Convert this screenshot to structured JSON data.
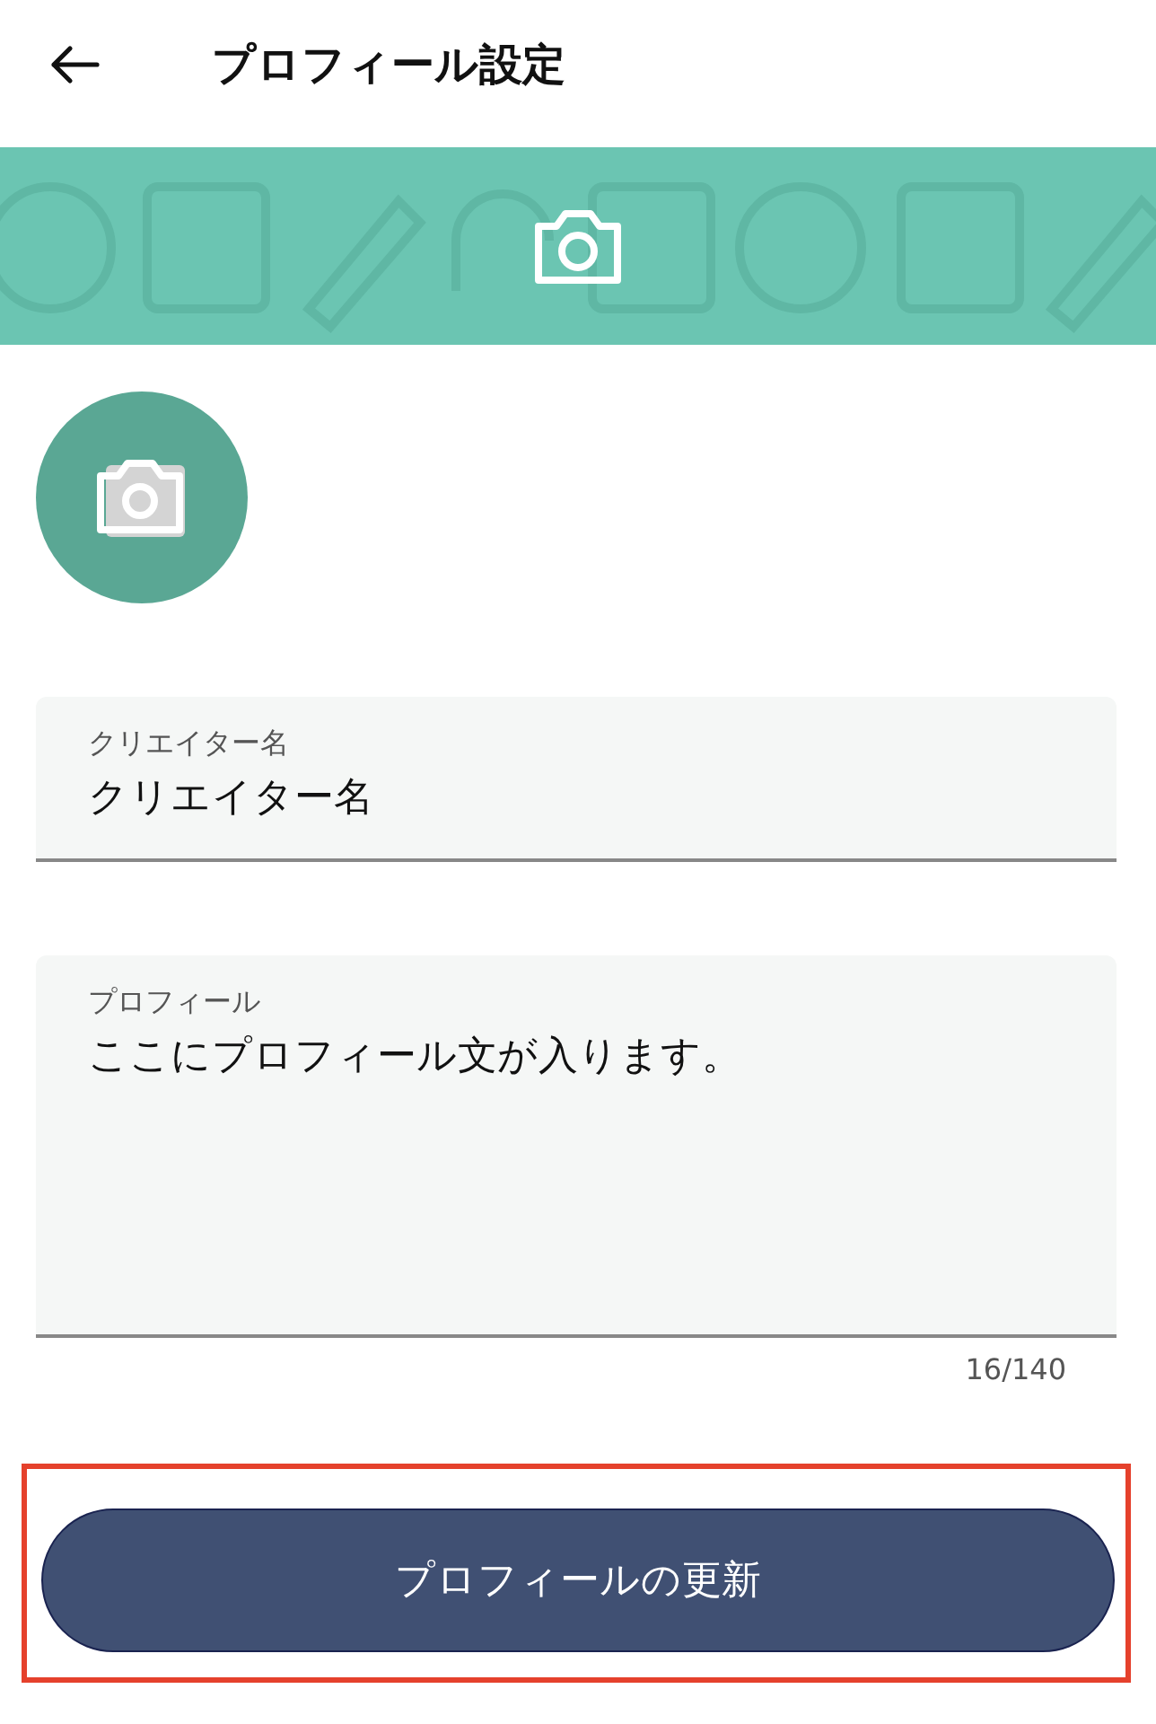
{
  "header": {
    "title": "プロフィール設定"
  },
  "fields": [
    {
      "kind": "input",
      "label": "クリエイター名",
      "value": "クリエイター名"
    },
    {
      "kind": "textarea",
      "label": "プロフィール",
      "value": "ここにプロフィール文が入ります。",
      "counter": "16/140"
    }
  ],
  "submit": {
    "label": "プロフィールの更新",
    "highlighted": true
  }
}
